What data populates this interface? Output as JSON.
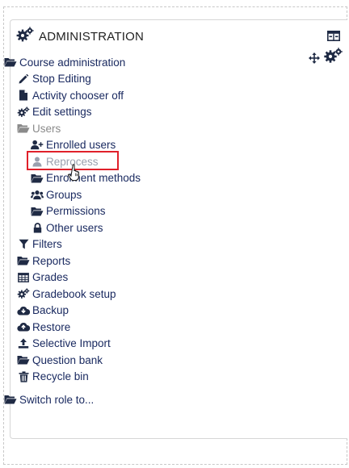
{
  "block": {
    "title": "ADMINISTRATION",
    "header_icon": "cogs-icon",
    "controls": [
      "collapse-dock-icon",
      "move-icon",
      "block-actions-cogs-icon"
    ]
  },
  "tree": [
    {
      "id": "course-administration",
      "label": "Course administration",
      "icon": "folder-open-icon",
      "level": 0
    },
    {
      "id": "stop-editing",
      "label": "Stop Editing",
      "icon": "pencil-icon",
      "level": 1
    },
    {
      "id": "activity-chooser",
      "label": "Activity chooser off",
      "icon": "file-icon",
      "level": 1
    },
    {
      "id": "edit-settings",
      "label": "Edit settings",
      "icon": "cogs-icon",
      "level": 1
    },
    {
      "id": "users",
      "label": "Users",
      "icon": "folder-open-icon",
      "level": 1,
      "style": "gray"
    },
    {
      "id": "enrolled-users",
      "label": "Enrolled users",
      "icon": "user-plus-icon",
      "level": 2
    },
    {
      "id": "reprocess",
      "label": "Reprocess",
      "icon": "user-icon",
      "level": 2,
      "style": "muted"
    },
    {
      "id": "enrolment-methods",
      "label": "Enrolment methods",
      "icon": "folder-open-icon",
      "level": 2
    },
    {
      "id": "groups",
      "label": "Groups",
      "icon": "users-icon",
      "level": 2
    },
    {
      "id": "permissions",
      "label": "Permissions",
      "icon": "folder-open-icon",
      "level": 2
    },
    {
      "id": "other-users",
      "label": "Other users",
      "icon": "lock-icon",
      "level": 2
    },
    {
      "id": "filters",
      "label": "Filters",
      "icon": "filter-icon",
      "level": 1
    },
    {
      "id": "reports",
      "label": "Reports",
      "icon": "folder-open-icon",
      "level": 1
    },
    {
      "id": "grades",
      "label": "Grades",
      "icon": "table-icon",
      "level": 1
    },
    {
      "id": "gradebook-setup",
      "label": "Gradebook setup",
      "icon": "cogs-icon",
      "level": 1
    },
    {
      "id": "backup",
      "label": "Backup",
      "icon": "cloud-download-icon",
      "level": 1
    },
    {
      "id": "restore",
      "label": "Restore",
      "icon": "cloud-upload-icon",
      "level": 1
    },
    {
      "id": "selective-import",
      "label": "Selective Import",
      "icon": "upload-icon",
      "level": 1
    },
    {
      "id": "question-bank",
      "label": "Question bank",
      "icon": "folder-open-icon",
      "level": 1
    },
    {
      "id": "recycle-bin",
      "label": "Recycle bin",
      "icon": "trash-icon",
      "level": 1
    }
  ],
  "switch_role": {
    "label": "Switch role to...",
    "icon": "folder-open-icon"
  },
  "colors": {
    "link": "#1a2a60",
    "muted_gray": "#8a8a8a",
    "highlight": "#e0202a",
    "icon_dark": "#1f2a44"
  }
}
